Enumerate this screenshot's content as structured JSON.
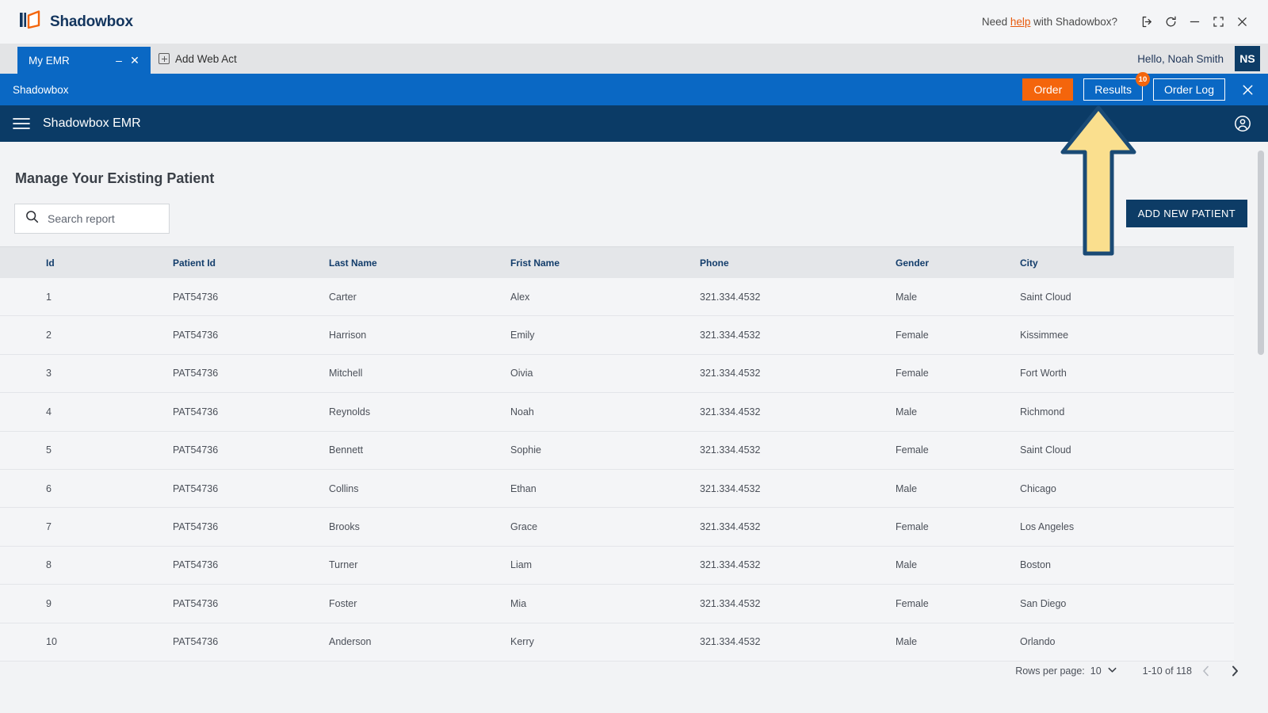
{
  "app": {
    "brand_name": "Shadowbox",
    "help_prefix": "Need ",
    "help_link": "help",
    "help_suffix": " with Shadowbox?",
    "window_controls": [
      {
        "name": "logout-icon",
        "glyph": "logout"
      },
      {
        "name": "refresh-icon",
        "glyph": "refresh"
      },
      {
        "name": "minimize-icon",
        "glyph": "minimize"
      },
      {
        "name": "restore-icon",
        "glyph": "restore"
      },
      {
        "name": "close-icon",
        "glyph": "close"
      }
    ]
  },
  "tabs": {
    "active_tab_label": "My EMR",
    "minimize_glyph": "–",
    "close_glyph": "✕",
    "add_tab_label": "Add Web Act"
  },
  "user": {
    "greeting": "Hello, Noah Smith",
    "initials": "NS"
  },
  "action_bar": {
    "title": "Shadowbox",
    "order_label": "Order",
    "results_label": "Results",
    "results_badge": "10",
    "order_log_label": "Order Log",
    "close_glyph": "✕",
    "accent_orange": "#f4650c",
    "bar_blue": "#0a68c4"
  },
  "emr_bar": {
    "title": "Shadowbox EMR",
    "navy": "#0b3b66"
  },
  "main": {
    "page_title": "Manage Your Existing Patient",
    "search_placeholder": "Search report",
    "search_value": "",
    "add_patient_label": "ADD NEW PATIENT"
  },
  "table": {
    "columns": [
      {
        "key": "id",
        "label": "Id"
      },
      {
        "key": "patient_id",
        "label": "Patient Id"
      },
      {
        "key": "last_name",
        "label": "Last Name"
      },
      {
        "key": "first_name",
        "label": "Frist Name"
      },
      {
        "key": "phone",
        "label": "Phone"
      },
      {
        "key": "gender",
        "label": "Gender"
      },
      {
        "key": "city",
        "label": "City"
      }
    ],
    "rows": [
      {
        "id": "1",
        "patient_id": "PAT54736",
        "last_name": "Carter",
        "first_name": "Alex",
        "phone": "321.334.4532",
        "gender": "Male",
        "city": "Saint Cloud"
      },
      {
        "id": "2",
        "patient_id": "PAT54736",
        "last_name": "Harrison",
        "first_name": "Emily",
        "phone": "321.334.4532",
        "gender": "Female",
        "city": "Kissimmee"
      },
      {
        "id": "3",
        "patient_id": "PAT54736",
        "last_name": "Mitchell",
        "first_name": "Oivia",
        "phone": "321.334.4532",
        "gender": "Female",
        "city": "Fort Worth"
      },
      {
        "id": "4",
        "patient_id": "PAT54736",
        "last_name": "Reynolds",
        "first_name": "Noah",
        "phone": "321.334.4532",
        "gender": "Male",
        "city": "Richmond"
      },
      {
        "id": "5",
        "patient_id": "PAT54736",
        "last_name": "Bennett",
        "first_name": "Sophie",
        "phone": "321.334.4532",
        "gender": "Female",
        "city": "Saint Cloud"
      },
      {
        "id": "6",
        "patient_id": "PAT54736",
        "last_name": "Collins",
        "first_name": "Ethan",
        "phone": "321.334.4532",
        "gender": "Male",
        "city": "Chicago"
      },
      {
        "id": "7",
        "patient_id": "PAT54736",
        "last_name": "Brooks",
        "first_name": "Grace",
        "phone": "321.334.4532",
        "gender": "Female",
        "city": "Los Angeles"
      },
      {
        "id": "8",
        "patient_id": "PAT54736",
        "last_name": "Turner",
        "first_name": "Liam",
        "phone": "321.334.4532",
        "gender": "Male",
        "city": "Boston"
      },
      {
        "id": "9",
        "patient_id": "PAT54736",
        "last_name": "Foster",
        "first_name": "Mia",
        "phone": "321.334.4532",
        "gender": "Female",
        "city": "San Diego"
      },
      {
        "id": "10",
        "patient_id": "PAT54736",
        "last_name": "Anderson",
        "first_name": "Kerry",
        "phone": "321.334.4532",
        "gender": "Male",
        "city": "Orlando"
      }
    ]
  },
  "pagination": {
    "rows_per_page_label": "Rows per page:",
    "rows_per_page_value": "10",
    "range_label": "1-10 of 118",
    "prev_glyph": "‹",
    "next_glyph": "›"
  },
  "annotation": {
    "arrow_fill": "#fadf8e",
    "arrow_stroke": "#1a4a75",
    "points_at": "results-button"
  }
}
